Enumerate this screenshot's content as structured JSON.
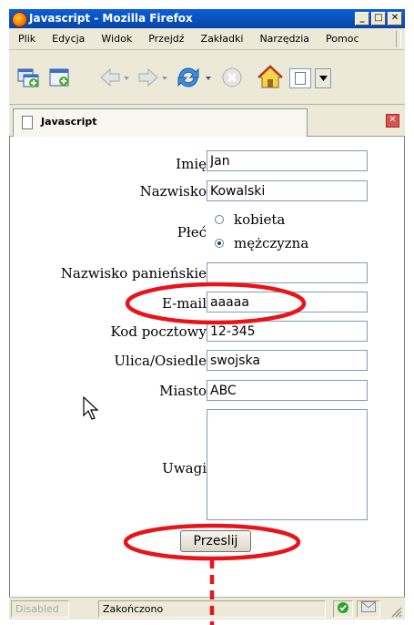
{
  "window": {
    "title": "Javascript - Mozilla Firefox",
    "minimize_glyph": "_",
    "maximize_glyph": "□",
    "close_glyph": "✕"
  },
  "menu": {
    "items": [
      "Plik",
      "Edycja",
      "Widok",
      "Przejdź",
      "Zakładki",
      "Narzędzia",
      "Pomoc"
    ]
  },
  "tab": {
    "title": "Javascript",
    "close_glyph": "✕"
  },
  "form": {
    "first_name": {
      "label": "Imię",
      "value": "Jan"
    },
    "last_name": {
      "label": "Nazwisko",
      "value": "Kowalski"
    },
    "gender": {
      "label": "Płeć",
      "options": [
        {
          "label": "kobieta",
          "checked": false
        },
        {
          "label": "mężczyzna",
          "checked": true
        }
      ]
    },
    "maiden_name": {
      "label": "Nazwisko panieńskie",
      "value": ""
    },
    "email": {
      "label": "E-mail",
      "value": "aaaaa"
    },
    "postal_code": {
      "label": "Kod pocztowy",
      "value": "12-345"
    },
    "street": {
      "label": "Ulica/Osiedle",
      "value": "swojska"
    },
    "city": {
      "label": "Miasto",
      "value": "ABC"
    },
    "notes": {
      "label": "Uwagi",
      "value": ""
    },
    "submit_label": "Przeslij"
  },
  "status": {
    "disabled_label": "Disabled",
    "text": "Zakończono"
  },
  "colors": {
    "titlebar": "#0845a8",
    "annotation_red": "#e8141a",
    "chrome": "#ece9d8"
  },
  "icons": [
    "firefox-logo-icon",
    "new-window-icon",
    "new-tab-icon",
    "back-icon",
    "forward-icon",
    "reload-icon",
    "stop-icon",
    "home-icon",
    "page-icon",
    "status-ok-icon",
    "mail-icon",
    "mouse-cursor-icon"
  ]
}
